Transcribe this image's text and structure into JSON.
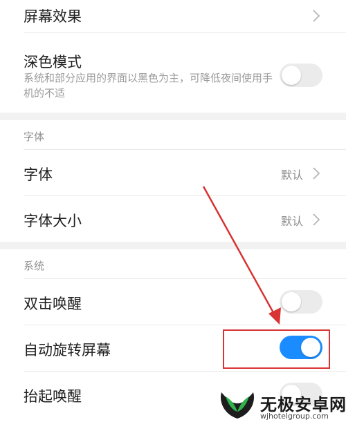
{
  "display": {
    "screen_effect": {
      "title": "屏幕效果"
    },
    "dark_mode": {
      "title": "深色模式",
      "description": "系统和部分应用的界面以黑色为主，可降低夜间使用手机的不适",
      "enabled": false
    }
  },
  "font_section": {
    "label": "字体",
    "items": [
      {
        "title": "字体",
        "value": "默认"
      },
      {
        "title": "字体大小",
        "value": "默认"
      }
    ]
  },
  "system_section": {
    "label": "系统",
    "items": [
      {
        "title": "双击唤醒",
        "enabled": false
      },
      {
        "title": "自动旋转屏幕",
        "enabled": true
      },
      {
        "title": "抬起唤醒",
        "enabled": false
      }
    ]
  },
  "watermark": {
    "name": "无极安卓网",
    "url": "wjhotelgroup.com"
  },
  "colors": {
    "accent": "#1a8cff",
    "annotation": "#d93333",
    "toggle_off": "#ebebeb"
  }
}
